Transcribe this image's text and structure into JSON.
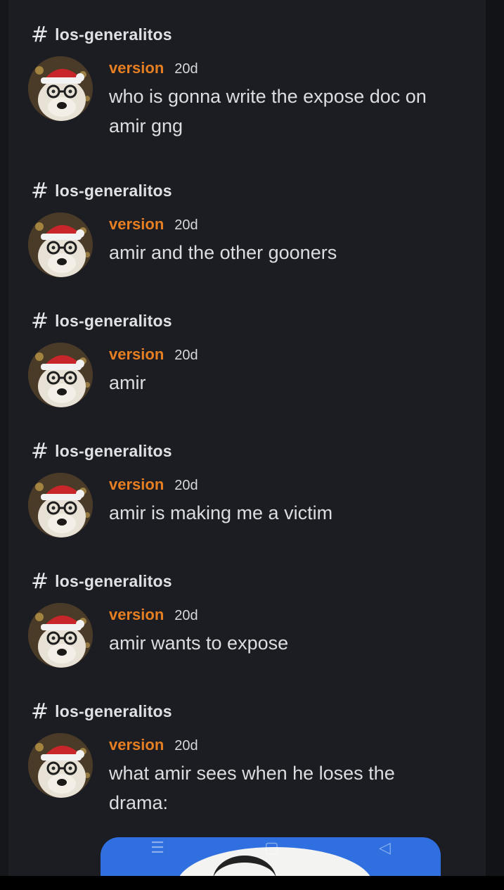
{
  "messages": [
    {
      "channel": "los-generalitos",
      "author": "version",
      "time": "20d",
      "text": "who is gonna write the expose doc on amir gng"
    },
    {
      "channel": "los-generalitos",
      "author": "version",
      "time": "20d",
      "text": "amir and the other gooners"
    },
    {
      "channel": "los-generalitos",
      "author": "version",
      "time": "20d",
      "text": "amir"
    },
    {
      "channel": "los-generalitos",
      "author": "version",
      "time": "20d",
      "text": "amir is making me a victim"
    },
    {
      "channel": "los-generalitos",
      "author": "version",
      "time": "20d",
      "text": "amir wants to expose"
    },
    {
      "channel": "los-generalitos",
      "author": "version",
      "time": "20d",
      "text": "what amir sees when he loses the drama:"
    }
  ],
  "icons": {
    "channel": "hash-icon",
    "avatar": "avatar-dog-santa-hat",
    "nav_menu": "recent-apps-icon",
    "nav_home": "home-icon",
    "nav_back": "back-icon"
  },
  "colors": {
    "author": "#e67e22",
    "panel": "#1c1d22",
    "text": "#dbdee1",
    "attachment": "#2f6fe0"
  }
}
